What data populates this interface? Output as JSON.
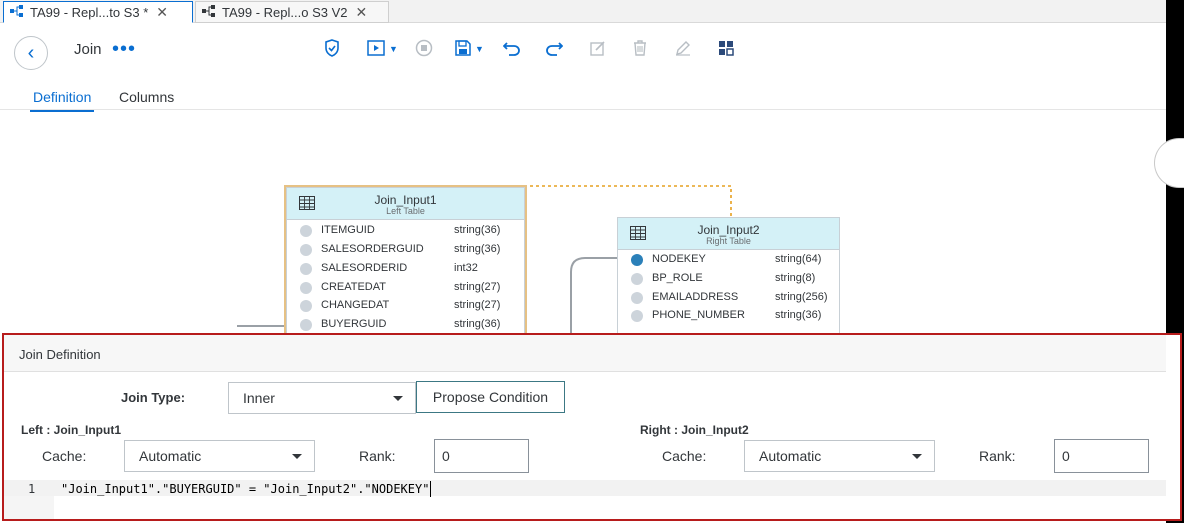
{
  "tabs": [
    {
      "label": "TA99 - Repl...to S3 *",
      "active": true
    },
    {
      "label": "TA99 - Repl...o S3 V2",
      "active": false
    }
  ],
  "toolbar": {
    "title": "Join",
    "more": "•••"
  },
  "subtabs": [
    "Definition",
    "Columns"
  ],
  "nodes": {
    "left": {
      "name": "Join_Input1",
      "role": "Left Table",
      "columns": [
        {
          "name": "ITEMGUID",
          "type": "string(36)",
          "key": false
        },
        {
          "name": "SALESORDERGUID",
          "type": "string(36)",
          "key": false
        },
        {
          "name": "SALESORDERID",
          "type": "int32",
          "key": false
        },
        {
          "name": "CREATEDAT",
          "type": "string(27)",
          "key": false
        },
        {
          "name": "CHANGEDAT",
          "type": "string(27)",
          "key": false
        },
        {
          "name": "BUYERGUID",
          "type": "string(36)",
          "key": false
        }
      ]
    },
    "right": {
      "name": "Join_Input2",
      "role": "Right Table",
      "columns": [
        {
          "name": "NODEKEY",
          "type": "string(64)",
          "key": true
        },
        {
          "name": "BP_ROLE",
          "type": "string(8)",
          "key": false
        },
        {
          "name": "EMAILADDRESS",
          "type": "string(256)",
          "key": false
        },
        {
          "name": "PHONE_NUMBER",
          "type": "string(36)",
          "key": false
        }
      ]
    }
  },
  "join": {
    "panel_title": "Join Definition",
    "type_label": "Join Type:",
    "type_value": "Inner",
    "propose_label": "Propose Condition",
    "left_label": "Left : Join_Input1",
    "right_label": "Right : Join_Input2",
    "cache_label": "Cache:",
    "cache_left": "Automatic",
    "cache_right": "Automatic",
    "rank_label": "Rank:",
    "rank_left": "0",
    "rank_right": "0",
    "line_number": "1",
    "condition": "\"Join_Input1\".\"BUYERGUID\" = \"Join_Input2\".\"NODEKEY\""
  },
  "colors": {
    "accent": "#0a6ed1",
    "node_header": "#d4f1f7",
    "highlight": "#b71c1c",
    "selection": "#e6a020"
  }
}
